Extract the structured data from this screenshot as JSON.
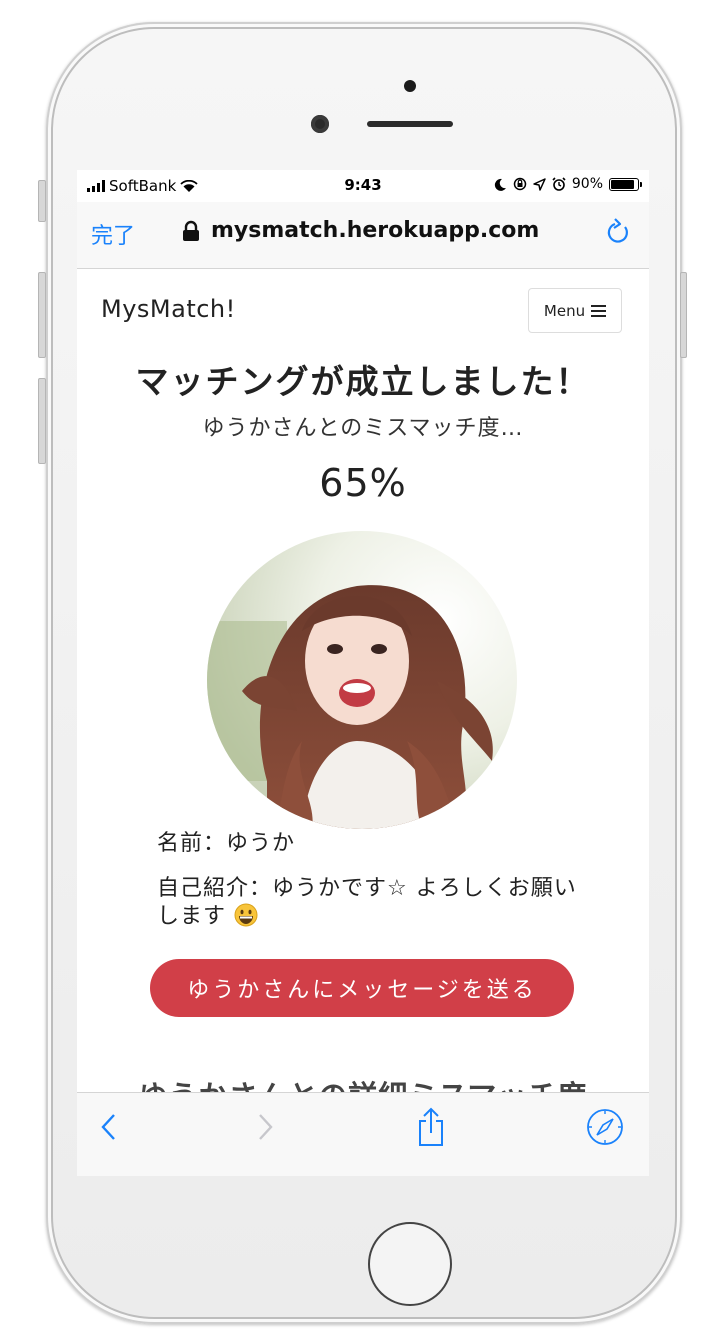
{
  "status_bar": {
    "carrier": "SoftBank",
    "time": "9:43",
    "battery": "90%",
    "battery_level": 0.9
  },
  "browser": {
    "done_label": "完了",
    "url": "mysmatch.herokuapp.com",
    "accent_color": "#1a82fb"
  },
  "header": {
    "brand": "MysMatch!",
    "menu_label": "Menu"
  },
  "match": {
    "headline": "マッチングが成立しました！",
    "subline": "ゆうかさんとのミスマッチ度…",
    "percent": "65%"
  },
  "profile": {
    "name_line": "名前：ゆうか",
    "intro_line": "自己紹介：ゆうかです☆ よろしくお願いします"
  },
  "actions": {
    "message_button": "ゆうかさんにメッセージを送る",
    "button_color": "#d13f48"
  },
  "detail": {
    "title": "ゆうかさんとの詳細ミスマッチ度"
  },
  "icons": {
    "back": "chevron-left-icon",
    "forward": "chevron-right-icon",
    "share": "share-icon",
    "compass": "compass-icon",
    "reload": "reload-icon",
    "lock": "lock-icon",
    "emoji": "grinning-face-icon"
  }
}
